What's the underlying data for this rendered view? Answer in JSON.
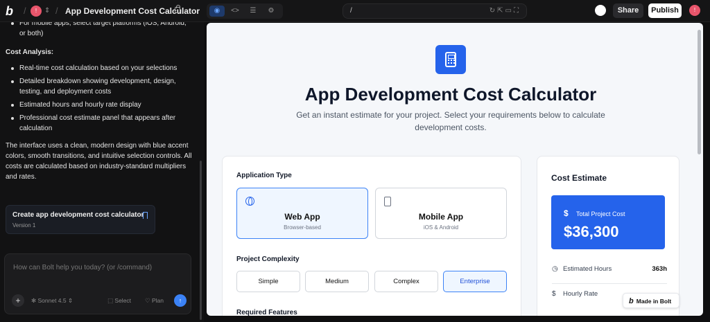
{
  "topbar": {
    "logo": "b",
    "avatar": "!",
    "project_title": "App Development Cost Calculator",
    "url": "/",
    "share_label": "Share",
    "publish_label": "Publish",
    "avatar_right": "!"
  },
  "chat": {
    "truncated_top": "For mobile apps, select target platforms (iOS, Android, or both)",
    "section": "Cost Analysis:",
    "bullets": [
      "Real-time cost calculation based on your selections",
      "Detailed breakdown showing development, design, testing, and deployment costs",
      "Estimated hours and hourly rate display",
      "Professional cost estimate panel that appears after calculation"
    ],
    "paragraph": "The interface uses a clean, modern design with blue accent colors, smooth transitions, and intuitive selection controls. All costs are calculated based on industry-standard multipliers and rates.",
    "version_title": "Create app development cost calculator",
    "version_label": "Version 1"
  },
  "composer": {
    "placeholder": "How can Bolt help you today? (or /command)",
    "model": "Sonnet 4.5",
    "select_label": "Select",
    "plan_label": "Plan"
  },
  "preview": {
    "title": "App Development Cost Calculator",
    "subtitle": "Get an instant estimate for your project. Select your requirements below to calculate development costs.",
    "app_type_label": "Application Type",
    "app_types": [
      {
        "name": "Web App",
        "desc": "Browser-based",
        "selected": true
      },
      {
        "name": "Mobile App",
        "desc": "iOS & Android",
        "selected": false
      }
    ],
    "complexity_label": "Project Complexity",
    "complexity": [
      "Simple",
      "Medium",
      "Complex",
      "Enterprise"
    ],
    "complexity_selected": "Enterprise",
    "features_label": "Required Features",
    "estimate": {
      "title": "Cost Estimate",
      "total_label": "Total Project Cost",
      "total": "$36,300",
      "hours_label": "Estimated Hours",
      "hours": "363h",
      "rate_label": "Hourly Rate"
    },
    "badge": "Made in Bolt",
    "accent": "#2563eb"
  }
}
